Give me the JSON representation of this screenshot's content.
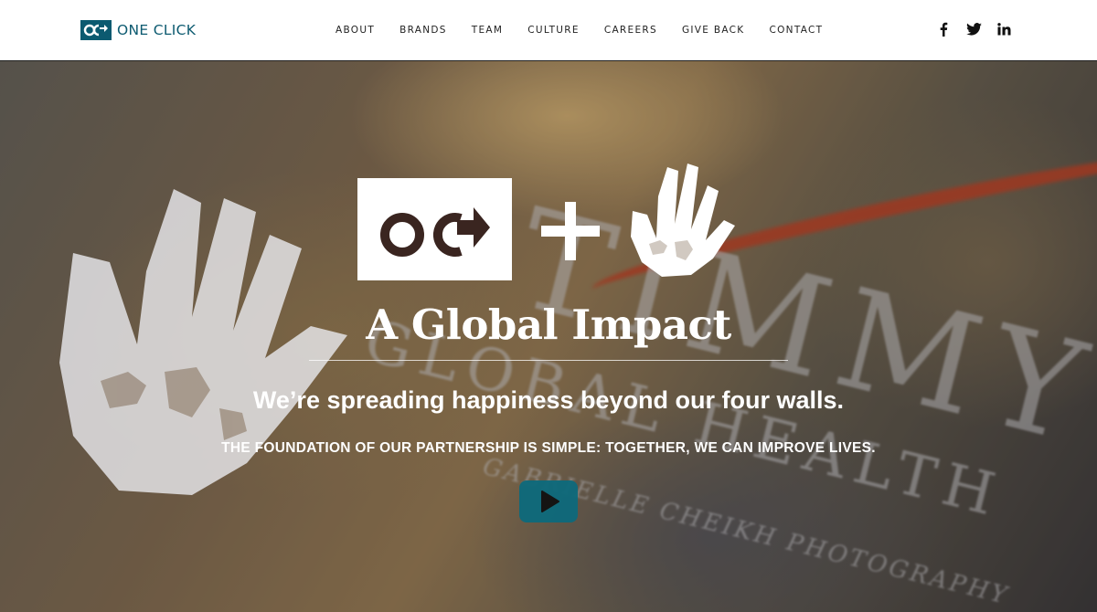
{
  "header": {
    "logo_text": "ONE CLICK",
    "logo_mark": "OC",
    "nav": [
      "ABOUT",
      "BRANDS",
      "TEAM",
      "CULTURE",
      "CAREERS",
      "GIVE BACK",
      "CONTACT"
    ],
    "social": [
      {
        "icon": "facebook-icon",
        "glyph": "f"
      },
      {
        "icon": "twitter-icon",
        "glyph": "🐦"
      },
      {
        "icon": "linkedin-icon",
        "glyph": "in"
      }
    ]
  },
  "hero": {
    "title": "A Global Impact",
    "subtitle": "We’re spreading happiness beyond our four walls.",
    "tagline": "THE FOUNDATION OF OUR PARTNERSHIP IS SIMPLE: TOGETHER, WE CAN IMPROVE LIVES.",
    "background_text": {
      "big": "TIMMY",
      "mid": "GLOBAL HEALTH",
      "small": "GABRIELLE CHEIKH PHOTOGRAPHY"
    },
    "play_icon": "play-icon"
  },
  "colors": {
    "brand": "#0c5a70",
    "play_button": "#0d6a7c"
  }
}
